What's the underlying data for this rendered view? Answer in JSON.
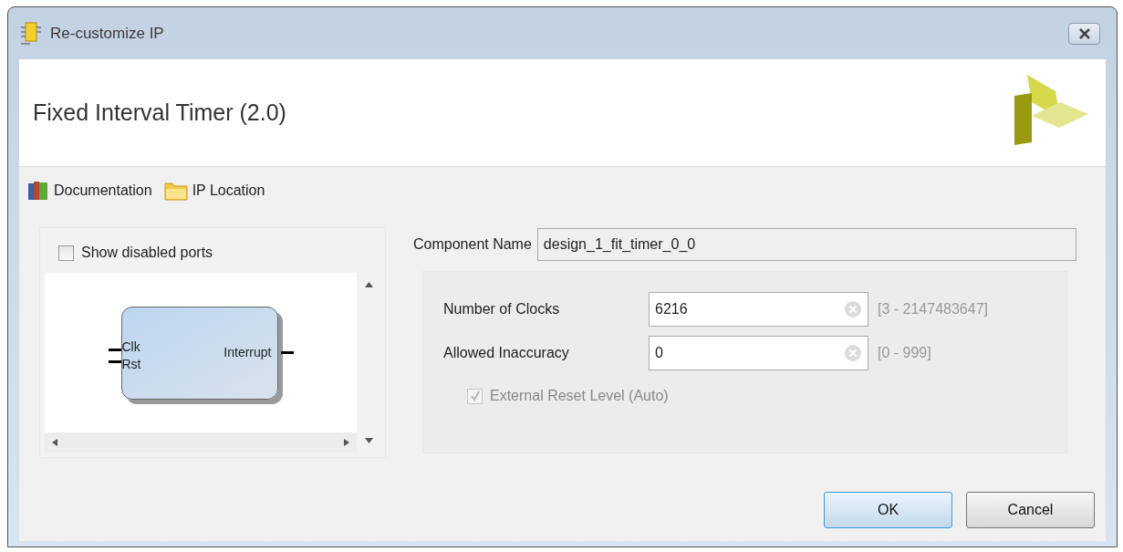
{
  "window": {
    "title": "Re-customize IP"
  },
  "header": {
    "title": "Fixed Interval Timer (2.0)"
  },
  "toolbar": [
    {
      "kind": "books",
      "label": "Documentation"
    },
    {
      "kind": "folder",
      "label": "IP Location"
    }
  ],
  "symbol_panel": {
    "show_disabled_ports": {
      "label": "Show disabled ports",
      "checked": false
    },
    "block": {
      "inputs": [
        "Clk",
        "Rst"
      ],
      "outputs": [
        "Interrupt"
      ]
    }
  },
  "component_name": {
    "label": "Component Name",
    "value": "design_1_fit_timer_0_0"
  },
  "params": [
    {
      "label": "Number of Clocks",
      "value": "6216",
      "range": "[3 - 2147483647]"
    },
    {
      "label": "Allowed Inaccuracy",
      "value": "0",
      "range": "[0 - 999]"
    }
  ],
  "external_reset": {
    "label": "External Reset Level (Auto)",
    "checked": true,
    "disabled": true
  },
  "buttons": [
    {
      "label": "OK",
      "selected": true
    },
    {
      "label": "Cancel",
      "selected": false
    }
  ]
}
